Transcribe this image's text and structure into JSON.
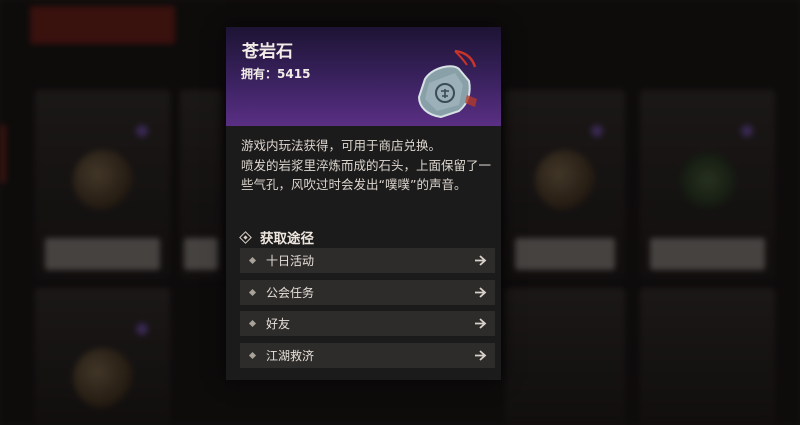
{
  "background": {
    "tabs": [
      "",
      ""
    ],
    "cards_top": [
      "",
      "",
      "",
      ""
    ],
    "cards_bottom": [
      "",
      "",
      "",
      ""
    ]
  },
  "item": {
    "name": "苍岩石",
    "owned_label": "拥有：",
    "owned_count": "5415",
    "icon": "rock-tag-icon",
    "description": [
      "游戏内玩法获得，可用于商店兑换。",
      "喷发的岩浆里淬炼而成的石头，上面保留了一些气孔，风吹过时会发出“噗噗”的声音。"
    ]
  },
  "sources": {
    "heading": "获取途径",
    "items": [
      {
        "label": "十日活动"
      },
      {
        "label": "公会任务"
      },
      {
        "label": "好友"
      },
      {
        "label": "江湖救济"
      }
    ]
  },
  "colors": {
    "header_purple": "#3b2260",
    "popup_bg": "#1c1b1b",
    "row_bg": "#2e2c2b",
    "accent_red": "#b8281c"
  }
}
